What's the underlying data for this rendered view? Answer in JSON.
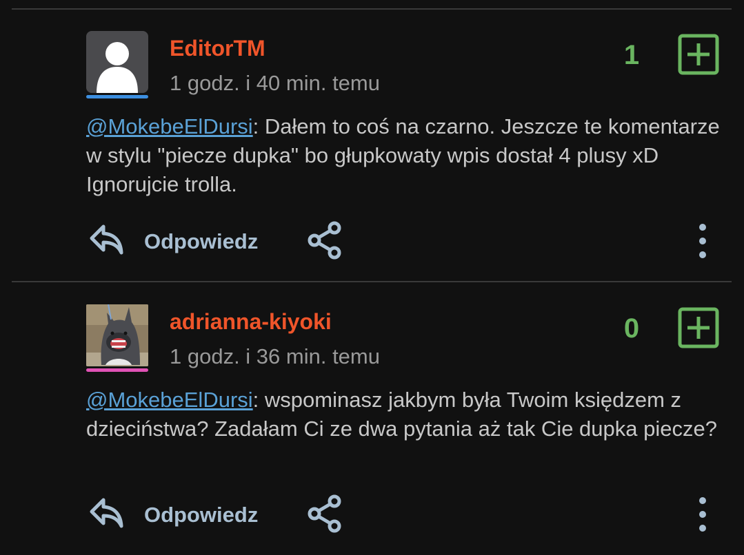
{
  "colors": {
    "background": "#111111",
    "author": "#f0552a",
    "score": "#6ab560",
    "mention": "#5aa1d6",
    "action": "#a9bfd2"
  },
  "comments": [
    {
      "author": "EditorTM",
      "time": "1 godz. i 40 min. temu",
      "score": "1",
      "mention": "@MokebeElDursi",
      "text": ": Dałem to coś na czarno. Jeszcze te komentarze w stylu \"piecze dupka\" bo głupkowaty wpis dostał 4 plusy xD Ignorujcie trolla.",
      "reply_label": "Odpowiedz",
      "avatar": "default-user-icon",
      "accent": "#3d8fe0"
    },
    {
      "author": "adrianna-kiyoki",
      "time": "1 godz. i 36 min. temu",
      "score": "0",
      "mention": "@MokebeElDursi",
      "text": ":  wspominasz jakbym była Twoim księdzem z dzieciństwa? Zadałam Ci ze dwa pytania aż tak Cie dupka piecze?",
      "reply_label": "Odpowiedz",
      "avatar": "dog-photo",
      "accent": "#e052b5"
    }
  ]
}
